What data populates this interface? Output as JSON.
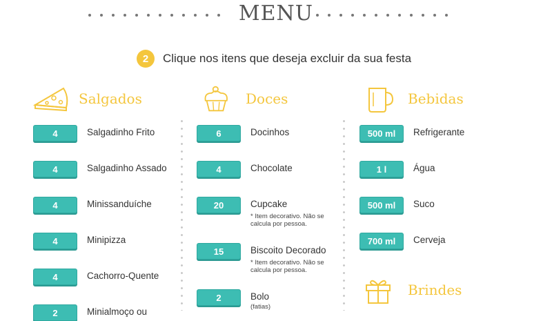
{
  "header": {
    "title": "MENU"
  },
  "step": {
    "number": "2",
    "text": "Clique nos itens que deseja excluir da sua festa"
  },
  "columns": {
    "salgados": {
      "title": "Salgados",
      "icon": "pizza-icon",
      "items": [
        {
          "qty": "4",
          "name": "Salgadinho Frito"
        },
        {
          "qty": "4",
          "name": "Salgadinho Assado"
        },
        {
          "qty": "4",
          "name": "Minissanduíche"
        },
        {
          "qty": "4",
          "name": "Minipizza"
        },
        {
          "qty": "4",
          "name": "Cachorro-Quente"
        },
        {
          "qty": "2",
          "name": "Minialmoço ou"
        }
      ]
    },
    "doces": {
      "title": "Doces",
      "icon": "cupcake-icon",
      "items": [
        {
          "qty": "6",
          "name": "Docinhos",
          "note": ""
        },
        {
          "qty": "4",
          "name": "Chocolate",
          "note": ""
        },
        {
          "qty": "20",
          "name": "Cupcake",
          "note": "* Item decorativo. Não se calcula por pessoa."
        },
        {
          "qty": "15",
          "name": "Biscoito Decorado",
          "note": "* Item decorativo. Não se calcula por pessoa."
        },
        {
          "qty": "2",
          "name": "Bolo",
          "note": "(fatias)"
        }
      ]
    },
    "bebidas": {
      "title": "Bebidas",
      "icon": "mug-icon",
      "items": [
        {
          "qty": "500 ml",
          "name": "Refrigerante"
        },
        {
          "qty": "1 l",
          "name": "Água"
        },
        {
          "qty": "500 ml",
          "name": "Suco"
        },
        {
          "qty": "700 ml",
          "name": "Cerveja"
        }
      ]
    },
    "brindes": {
      "title": "Brindes",
      "icon": "gift-icon"
    }
  },
  "colors": {
    "accent": "#f4c63d",
    "button": "#3dbdb3"
  }
}
